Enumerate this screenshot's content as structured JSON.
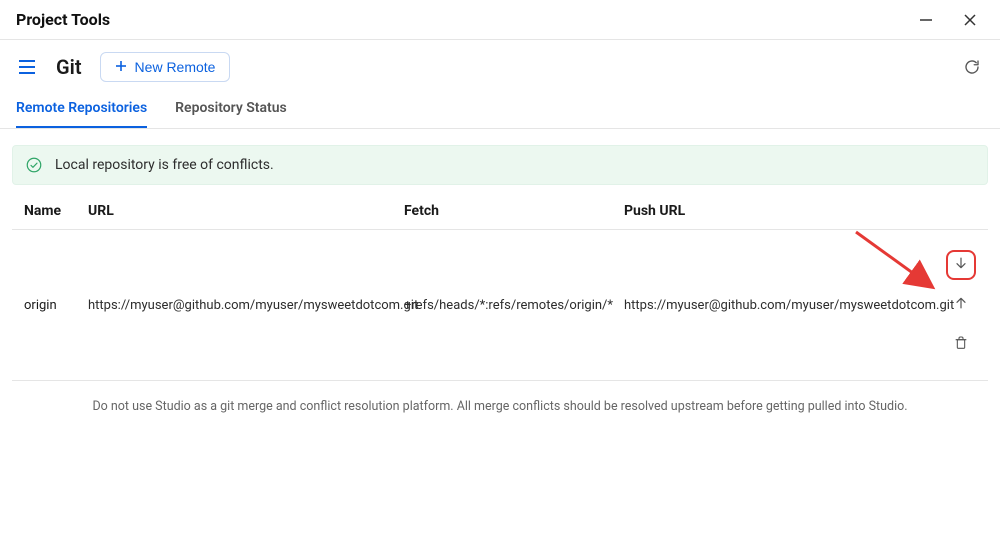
{
  "window": {
    "title": "Project Tools"
  },
  "page": {
    "heading": "Git",
    "new_remote_label": "New Remote"
  },
  "tabs": {
    "remote_repos": "Remote Repositories",
    "repo_status": "Repository Status"
  },
  "status": {
    "message": "Local repository is free of conflicts."
  },
  "columns": {
    "name": "Name",
    "url": "URL",
    "fetch": "Fetch",
    "push": "Push URL"
  },
  "rows": [
    {
      "name": "origin",
      "url": "https://myuser@github.com/myuser/mysweetdotcom.git",
      "fetch": "+refs/heads/*:refs/remotes/origin/*",
      "push_url": "https://myuser@github.com/myuser/mysweetdotcom.git"
    }
  ],
  "footer": {
    "note": "Do not use Studio as a git merge and conflict resolution platform. All merge conflicts should be resolved upstream before getting pulled into Studio."
  }
}
